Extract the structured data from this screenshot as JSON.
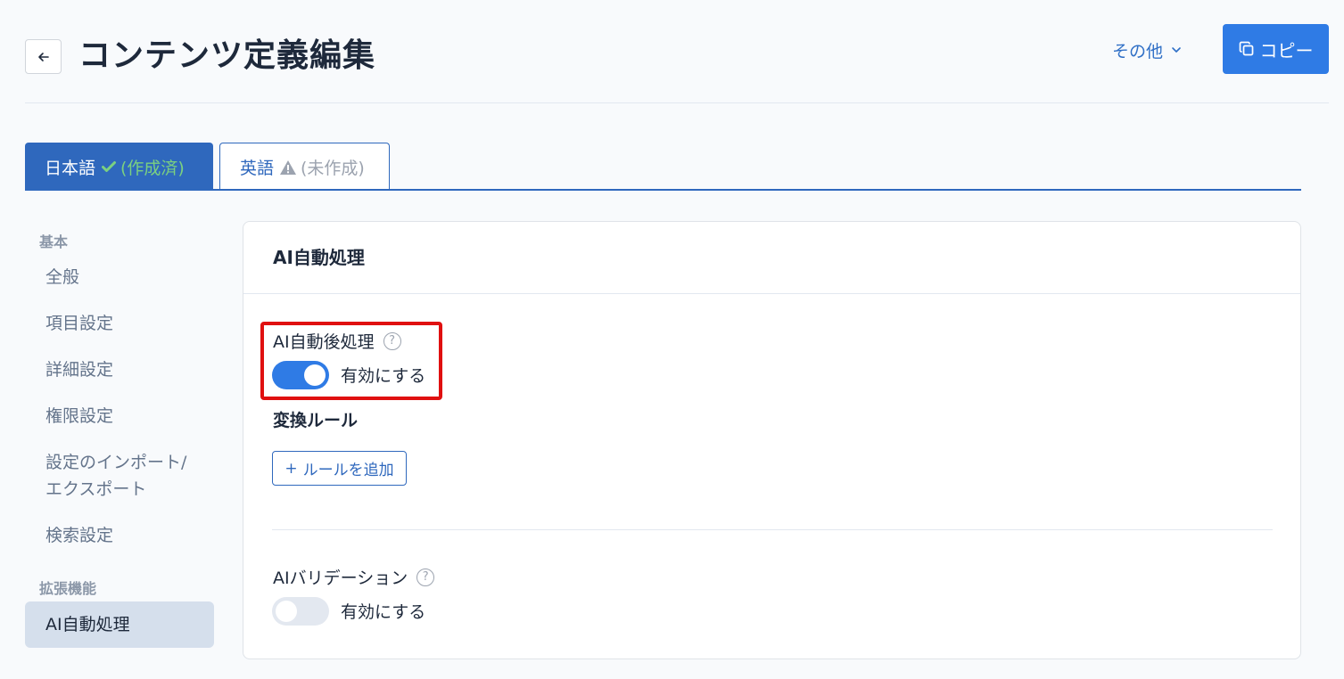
{
  "header": {
    "title": "コンテンツ定義編集",
    "more_label": "その他",
    "copy_label": "コピー"
  },
  "tabs": [
    {
      "label": "日本語",
      "status": "(作成済)"
    },
    {
      "label": "英語",
      "status": "(未作成)"
    }
  ],
  "sidebar": {
    "sections": [
      {
        "heading": "基本",
        "items": [
          "全般",
          "項目設定",
          "詳細設定",
          "権限設定",
          "設定のインポート/エクスポート",
          "検索設定"
        ]
      },
      {
        "heading": "拡張機能",
        "items": [
          "AI自動処理"
        ]
      }
    ],
    "active_item": "AI自動処理"
  },
  "card": {
    "title": "AI自動処理",
    "post_processing": {
      "label": "AI自動後処理",
      "toggle_text": "有効にする",
      "enabled": true
    },
    "conversion_rules": {
      "label": "変換ルール",
      "add_button": "ルールを追加"
    },
    "validation": {
      "label": "AIバリデーション",
      "toggle_text": "有効にする",
      "enabled": false
    }
  },
  "colors": {
    "primary": "#2f7be5",
    "tab_active": "#2f68bd",
    "highlight": "#e01010",
    "success": "#7bd080"
  }
}
